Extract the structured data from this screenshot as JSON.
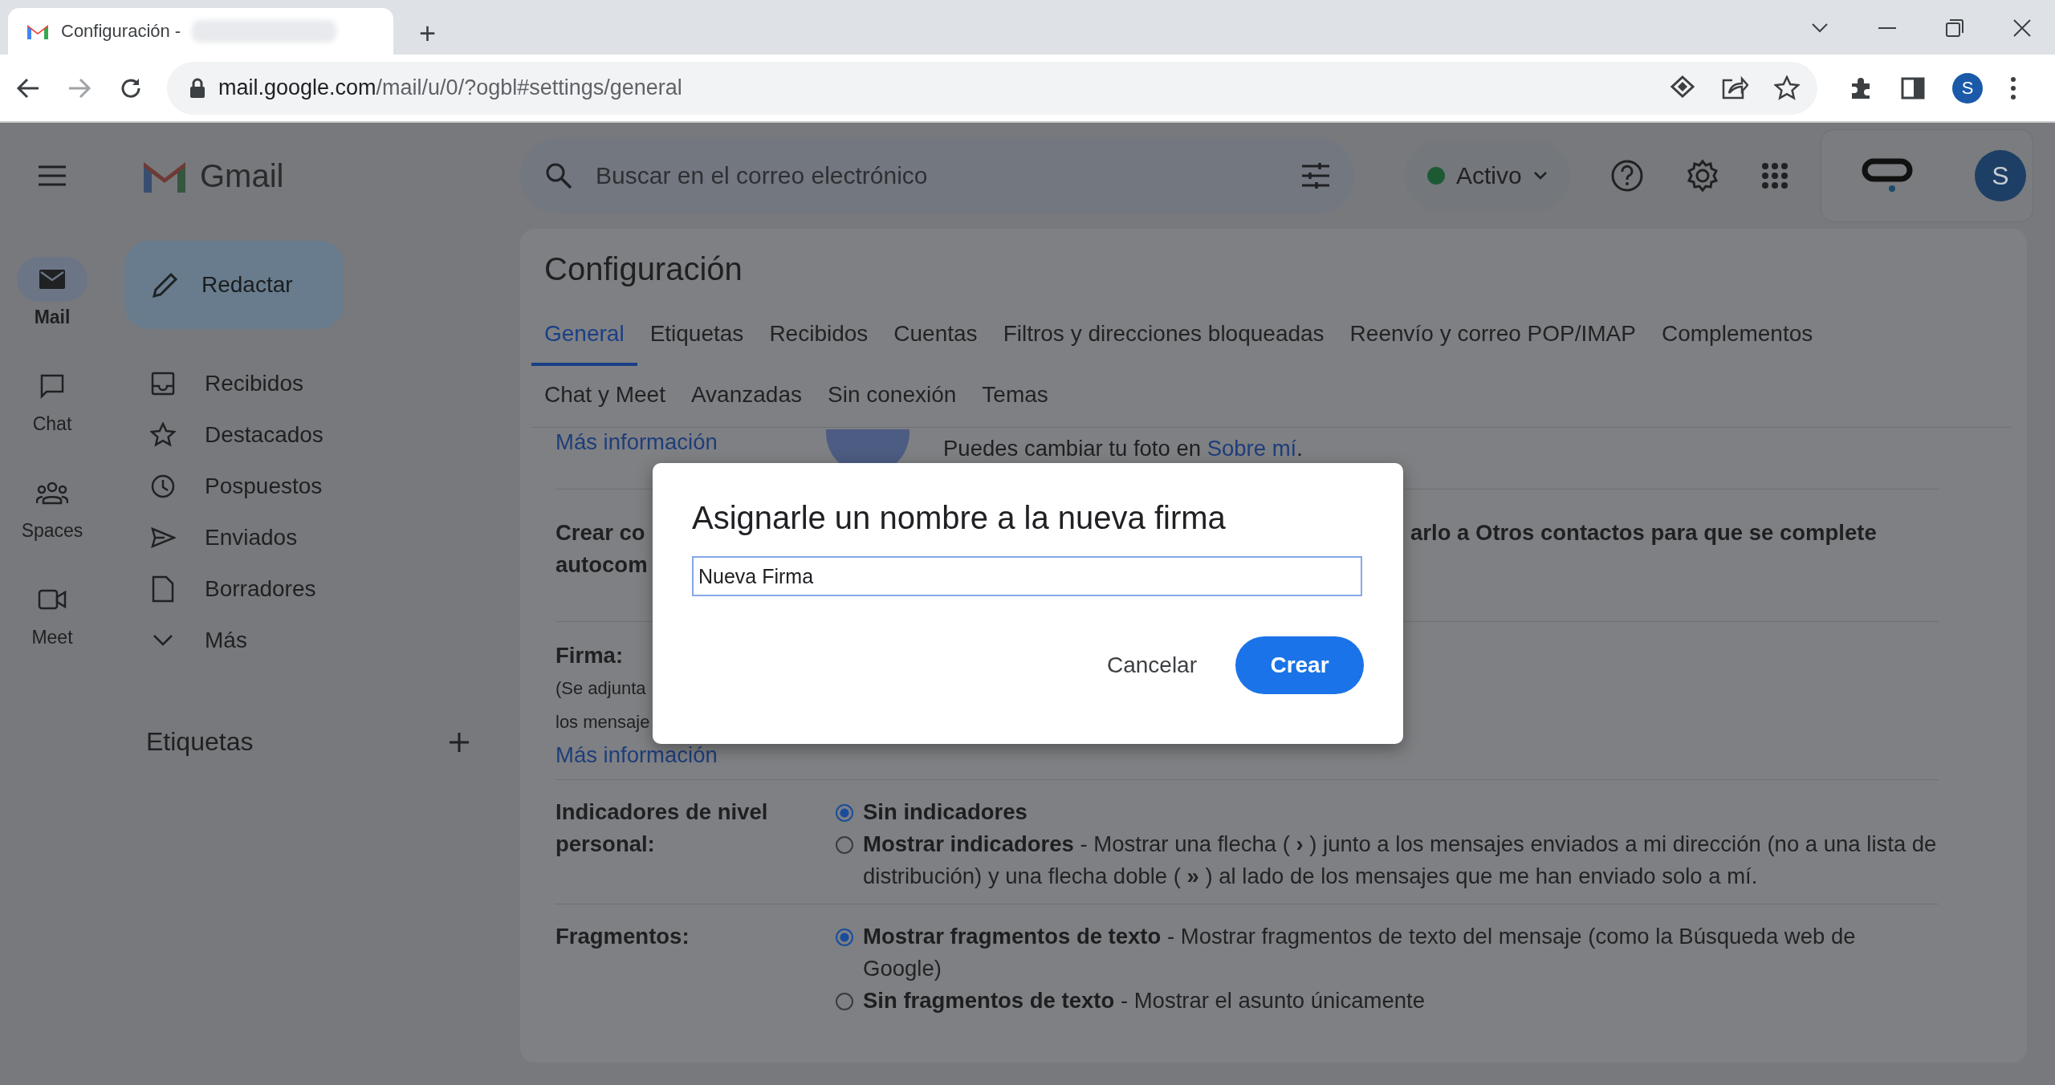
{
  "browser": {
    "tab": {
      "title": "Configuración -"
    },
    "new_tab": "+",
    "url": {
      "host": "mail.google.com",
      "path": "/mail/u/0/?ogbl#settings/general"
    },
    "profile": "S"
  },
  "header": {
    "logo": "Gmail",
    "search": {
      "placeholder": "Buscar en el correo electrónico"
    },
    "status": "Activo",
    "avatar": "S"
  },
  "app_rail": [
    {
      "label": "Mail",
      "kind": "mail",
      "selected": true
    },
    {
      "label": "Chat",
      "kind": "chat",
      "selected": false
    },
    {
      "label": "Spaces",
      "kind": "spaces",
      "selected": false
    },
    {
      "label": "Meet",
      "kind": "meet",
      "selected": false
    }
  ],
  "compose": "Redactar",
  "nav": [
    {
      "label": "Recibidos",
      "kind": "inbox"
    },
    {
      "label": "Destacados",
      "kind": "star"
    },
    {
      "label": "Pospuestos",
      "kind": "clock"
    },
    {
      "label": "Enviados",
      "kind": "send"
    },
    {
      "label": "Borradores",
      "kind": "draft"
    },
    {
      "label": "Más",
      "kind": "more"
    }
  ],
  "labels_heading": "Etiquetas",
  "settings": {
    "title": "Configuración",
    "tab_rows": [
      {
        "tabs": [
          {
            "label": "General",
            "selected": true
          },
          {
            "label": "Etiquetas",
            "selected": false
          },
          {
            "label": "Recibidos",
            "selected": false
          },
          {
            "label": "Cuentas",
            "selected": false
          },
          {
            "label": "Filtros y direcciones bloqueadas",
            "selected": false
          },
          {
            "label": "Reenvío y correo POP/IMAP",
            "selected": false
          },
          {
            "label": "Complementos",
            "selected": false
          }
        ]
      },
      {
        "tabs": [
          {
            "label": "Chat y Meet",
            "selected": false
          },
          {
            "label": "Avanzadas",
            "selected": false
          },
          {
            "label": "Sin conexión",
            "selected": false
          },
          {
            "label": "Temas",
            "selected": false
          }
        ]
      }
    ],
    "sections": [
      {
        "kind": "photo",
        "link": "Más información",
        "text": "Puedes cambiar tu foto en",
        "text_link": "Sobre mí",
        "text_end": "."
      },
      {
        "kind": "contacts",
        "label_lines": [
          "Crear co",
          "autocom"
        ],
        "text": "arlo a Otros contactos para que se complete"
      },
      {
        "kind": "signature",
        "label": "Firma:",
        "notes": [
          "(Se adjunta",
          "los mensaje"
        ],
        "link": "Más información"
      },
      {
        "kind": "radios",
        "label": "Indicadores de nivel personal:",
        "options": [
          {
            "title": "Sin indicadores",
            "selected": true
          },
          {
            "title": "Mostrar indicadores",
            "description": "- Mostrar una flecha ( **›** ) junto a los mensajes enviados a mi dirección (no a una lista de distribución) y una flecha doble ( **»** ) al lado de los mensajes que me han enviado solo a mí.",
            "selected": false
          }
        ]
      },
      {
        "kind": "radios",
        "label": "Fragmentos:",
        "options": [
          {
            "title": "Mostrar fragmentos de texto",
            "description": "- Mostrar fragmentos de texto del mensaje (como la Búsqueda web de Google)",
            "selected": true
          },
          {
            "title": "Sin fragmentos de texto",
            "description": "- Mostrar el asunto únicamente",
            "selected": false
          }
        ]
      }
    ]
  },
  "dialog": {
    "title": "Asignarle un nombre a la nueva firma",
    "input": {
      "value": "Nueva Firma"
    },
    "buttons": [
      {
        "label": "Cancelar",
        "kind": "text"
      },
      {
        "label": "Crear",
        "kind": "primary"
      }
    ]
  }
}
